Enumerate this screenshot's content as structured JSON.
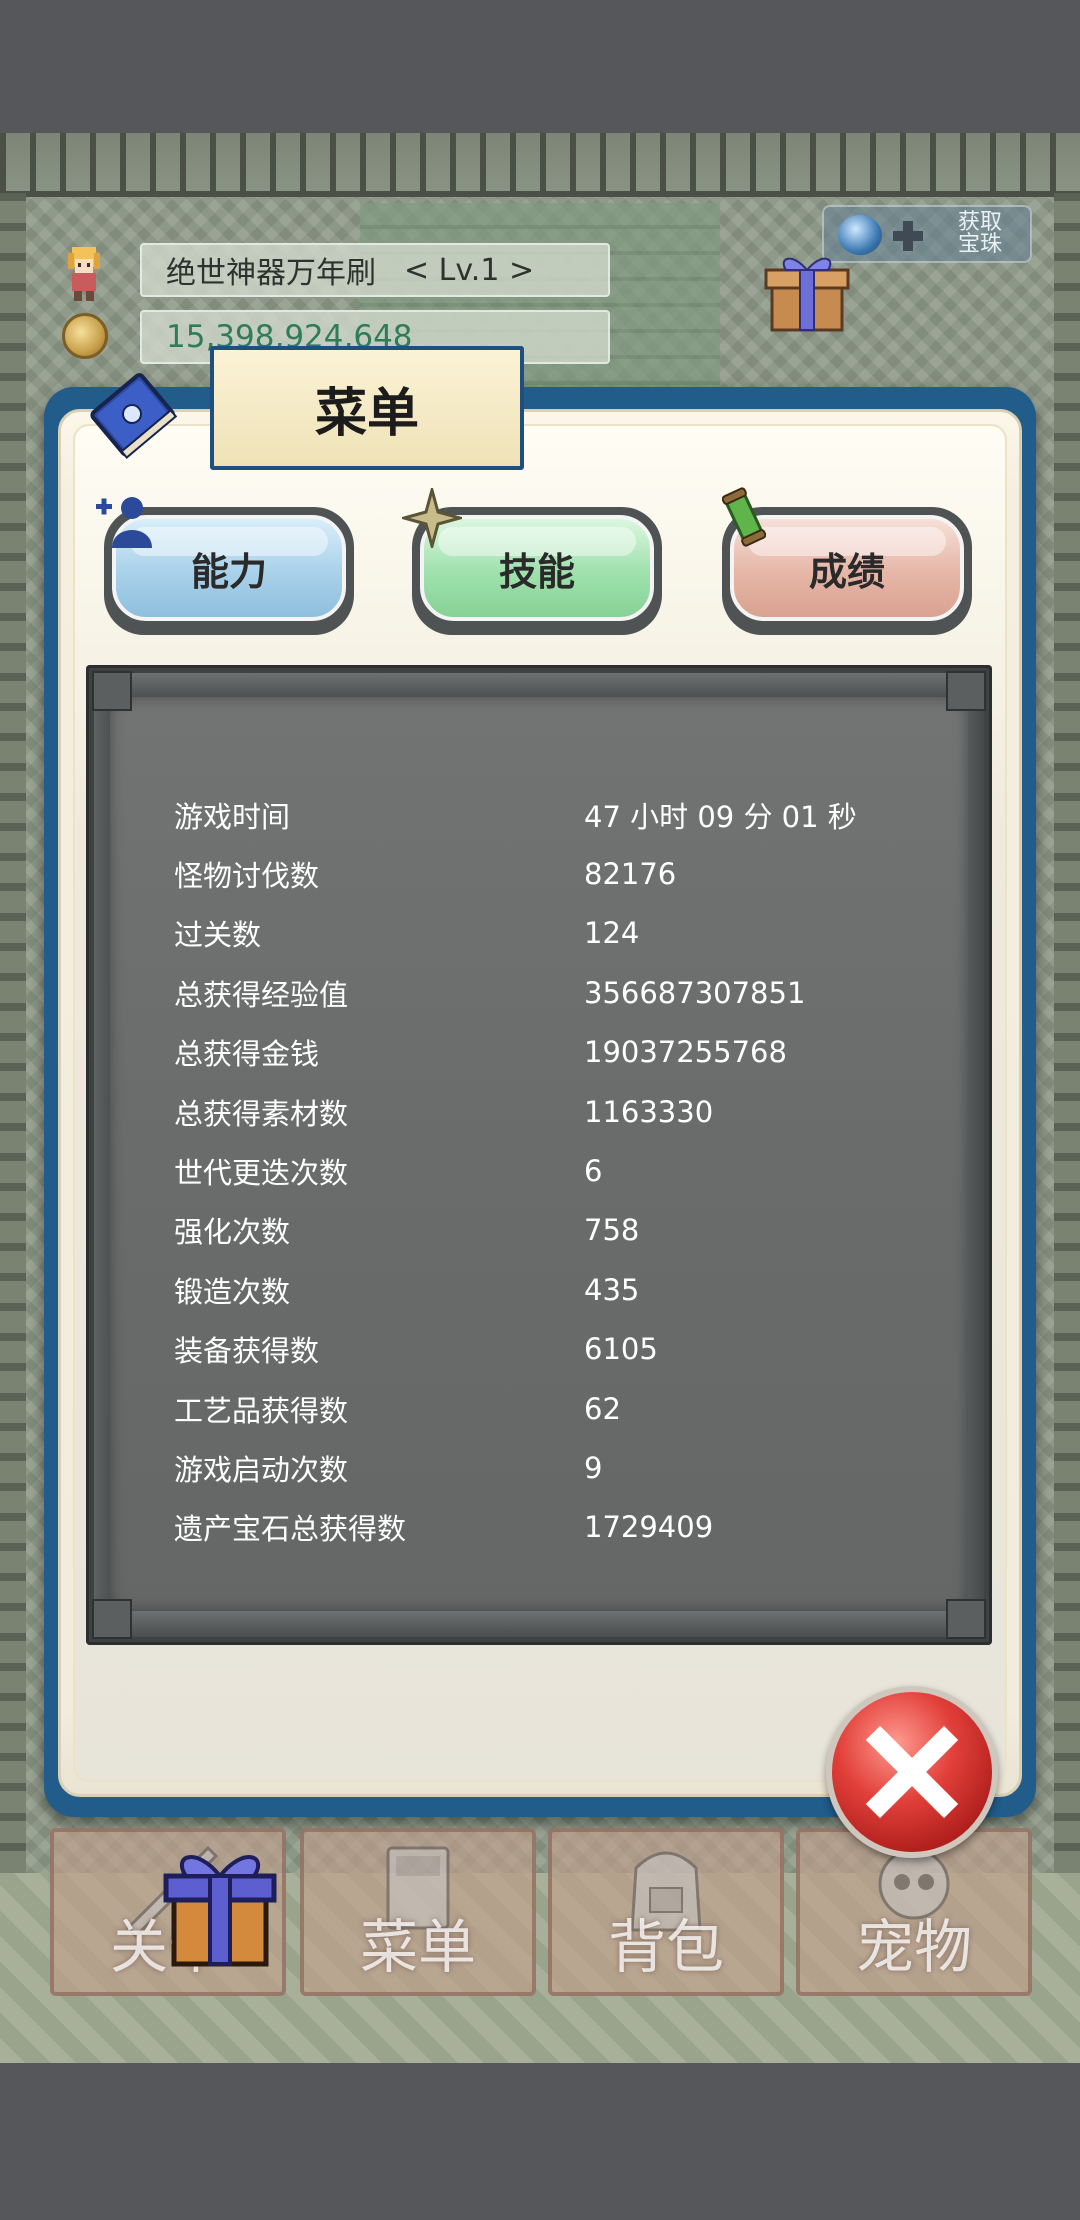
{
  "hud": {
    "weapon_name": "绝世神器万年刷",
    "weapon_level": "< Lv.1 >",
    "gold": "15,398,924,648",
    "get_gem_label": "获取宝珠"
  },
  "modal": {
    "title": "菜单",
    "tabs": [
      {
        "label": "能力",
        "color": "#a9d1ea"
      },
      {
        "label": "技能",
        "color": "#9fe1ad"
      },
      {
        "label": "成绩",
        "color": "#e6b6a7"
      }
    ],
    "active_tab": "成绩",
    "stats": [
      {
        "label": "游戏时间",
        "value": "47 小时 09 分 01 秒"
      },
      {
        "label": "怪物讨伐数",
        "value": "82176"
      },
      {
        "label": "过关数",
        "value": "124"
      },
      {
        "label": "总获得经验值",
        "value": "356687307851"
      },
      {
        "label": "总获得金钱",
        "value": "19037255768"
      },
      {
        "label": "总获得素材数",
        "value": "1163330"
      },
      {
        "label": "世代更迭次数",
        "value": "6"
      },
      {
        "label": "强化次数",
        "value": "758"
      },
      {
        "label": "锻造次数",
        "value": "435"
      },
      {
        "label": "装备获得数",
        "value": "6105"
      },
      {
        "label": "工艺品获得数",
        "value": "62"
      },
      {
        "label": "游戏启动次数",
        "value": "9"
      },
      {
        "label": "遗产宝石总获得数",
        "value": "1729409"
      }
    ]
  },
  "nav": {
    "stage": "关卡",
    "menu": "菜单",
    "bag": "背包",
    "pet": "宠物"
  },
  "colors": {
    "modal_border": "#215c8a",
    "close_button": "#e2403a",
    "stats_panel": "#6a6c6c"
  },
  "icons": {
    "hero": "hero-sprite-icon",
    "coin": "coin-icon",
    "gift": "gift-box-icon",
    "gem": "gem-icon",
    "book": "spellbook-icon",
    "ability": "add-person-icon",
    "skill": "sparkle-star-icon",
    "record": "scroll-icon",
    "close": "close-x-icon"
  }
}
